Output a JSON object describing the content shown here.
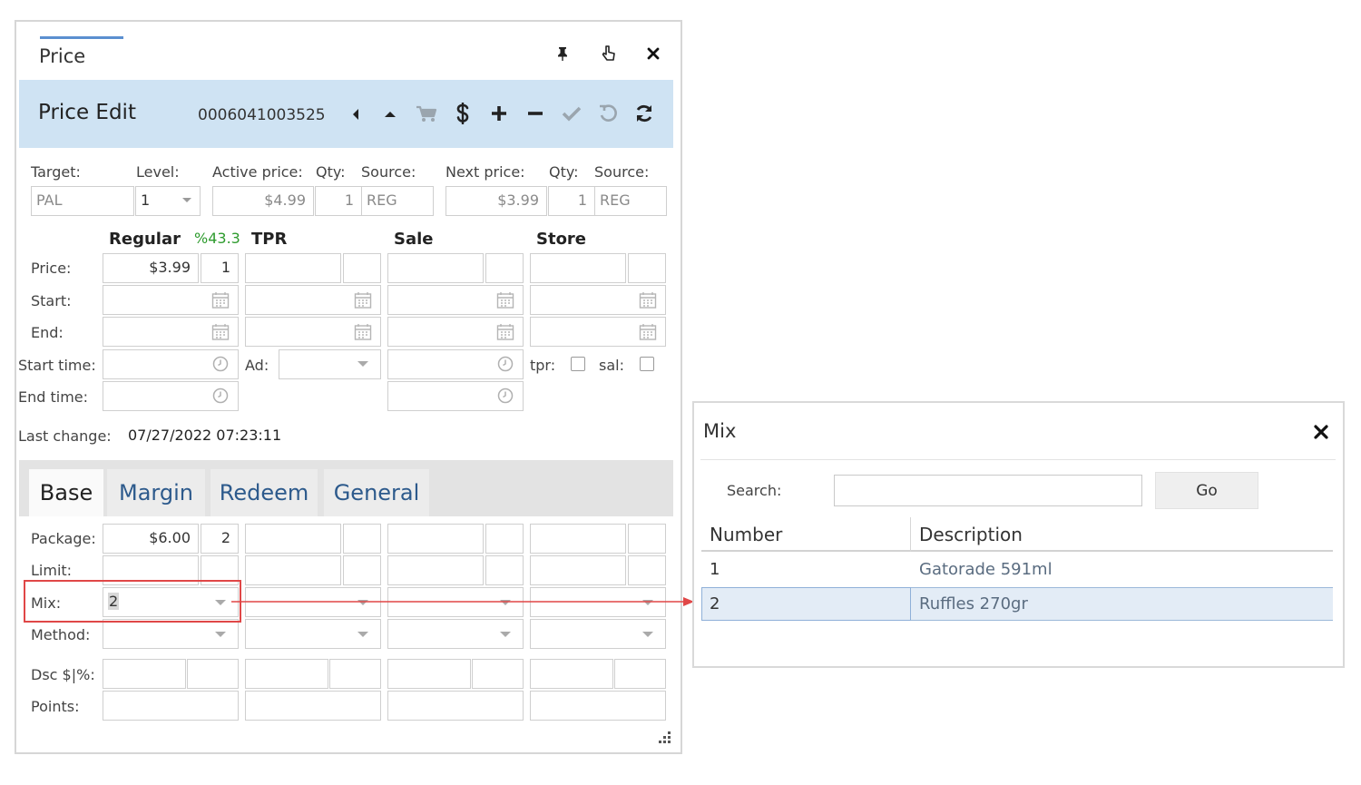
{
  "price_window": {
    "title": "Price",
    "header_title": "Price Edit",
    "upc": "0006041003525",
    "toolbar_icons": [
      "caret-left-icon",
      "caret-up-icon",
      "cart-icon",
      "dollar-icon",
      "plus-icon",
      "minus-icon",
      "check-icon",
      "undo-icon",
      "refresh-icon"
    ]
  },
  "summary": {
    "target_label": "Target:",
    "level_label": "Level:",
    "active_price_label": "Active price:",
    "qty_label": "Qty:",
    "source_label": "Source:",
    "next_price_label": "Next price:",
    "target_value": "PAL",
    "level_value": "1",
    "active_price": "$4.99",
    "active_qty": "1",
    "active_source": "REG",
    "next_price": "$3.99",
    "next_qty": "1",
    "next_source": "REG"
  },
  "columns": {
    "regular": "Regular",
    "margin_pct": "%43.3",
    "tpr": "TPR",
    "sale": "Sale",
    "store": "Store"
  },
  "rows": {
    "price": "Price:",
    "start": "Start:",
    "end": "End:",
    "start_time": "Start time:",
    "end_time": "End time:",
    "ad": "Ad:",
    "tpr": "tpr:",
    "sal": "sal:"
  },
  "regular_values": {
    "price": "$3.99",
    "qty": "1"
  },
  "last_change": {
    "label": "Last change:",
    "value": "07/27/2022 07:23:11"
  },
  "tabs": [
    "Base",
    "Margin",
    "Redeem",
    "General"
  ],
  "base": {
    "package_label": "Package:",
    "limit_label": "Limit:",
    "mix_label": "Mix:",
    "method_label": "Method:",
    "dsc_label": "Dsc $|%:",
    "points_label": "Points:",
    "package_price": "$6.00",
    "package_qty": "2",
    "mix_value": "2"
  },
  "mix_window": {
    "title": "Mix",
    "search_label": "Search:",
    "search_value": "",
    "go_label": "Go",
    "columns": [
      "Number",
      "Description"
    ],
    "rows": [
      {
        "number": "1",
        "description": "Gatorade 591ml"
      },
      {
        "number": "2",
        "description": "Ruffles 270gr"
      }
    ],
    "selected_row": 2
  },
  "colors": {
    "header_bg": "#cfe3f3",
    "accent_blue": "#5b8fd0",
    "link_blue": "#2d5a8c",
    "green": "#2e9b2e",
    "highlight_red": "#e04747",
    "selected_row_bg": "#e3ecf6"
  }
}
